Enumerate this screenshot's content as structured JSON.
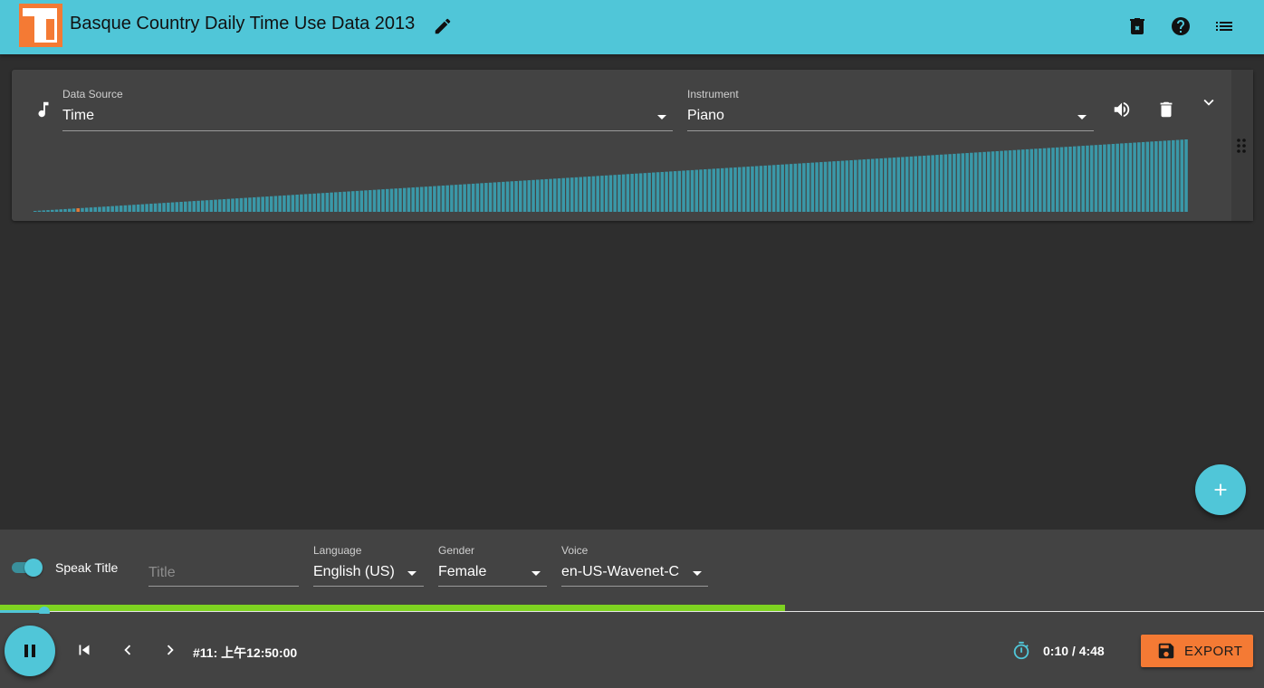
{
  "app": {
    "title": "Basque Country Daily Time Use Data 2013",
    "logo_letter": "T",
    "brand_color": "#50c6d8",
    "accent_color": "#f47a34",
    "icons": {
      "edit": "pencil-icon",
      "clear": "trash-x-icon",
      "help": "help-circle-icon",
      "menu": "list-icon"
    }
  },
  "track": {
    "source_label": "Data Source",
    "source_value": "Time",
    "instrument_label": "Instrument",
    "instrument_value": "Piano",
    "icons": {
      "track": "music-note-icon",
      "volume": "volume-icon",
      "delete": "trash-icon",
      "collapse": "chevron-down-icon",
      "drag": "drag-handle-icon"
    },
    "waveform": {
      "bar_count": 269,
      "highlight_index": 10,
      "bar_color": "#3a98a8",
      "highlight_color": "#e07b39"
    }
  },
  "speech": {
    "speak_title_label": "Speak Title",
    "speak_title_on": true,
    "title_placeholder": "Title",
    "language_label": "Language",
    "language_value": "English (US)",
    "gender_label": "Gender",
    "gender_value": "Female",
    "voice_label": "Voice",
    "voice_value": "en-US-Wavenet-C"
  },
  "player": {
    "current_point": "#11: 上午12:50:00",
    "time": "0:10 / 4:48",
    "progress_fraction": 0.035,
    "buffer_fraction": 0.621,
    "export_label": "EXPORT",
    "icons": {
      "play": "pause-icon",
      "first": "skip-previous-icon",
      "prev": "chevron-left-icon",
      "next": "chevron-right-icon",
      "speed": "timer-icon",
      "export": "save-icon"
    }
  }
}
